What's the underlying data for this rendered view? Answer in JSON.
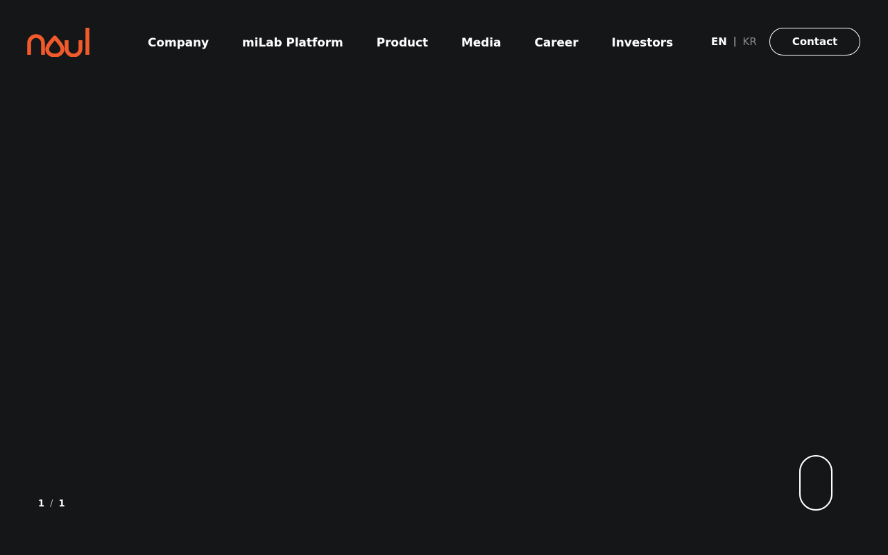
{
  "brand": {
    "logo_icon": "noul-logo",
    "accent_color": "#F15A2B"
  },
  "nav": {
    "items": [
      {
        "label": "Company"
      },
      {
        "label": "miLab Platform"
      },
      {
        "label": "Product"
      },
      {
        "label": "Media"
      },
      {
        "label": "Career"
      },
      {
        "label": "Investors"
      }
    ]
  },
  "language": {
    "active": "EN",
    "separator": "|",
    "other": "KR"
  },
  "header": {
    "contact_label": "Contact"
  },
  "pagination": {
    "current": "1",
    "separator": "/",
    "total": "1"
  },
  "scroll_indicator": {
    "icon": "mouse-scroll-icon"
  },
  "theme": {
    "background": "#151618",
    "text": "#FFFFFF",
    "muted": "#8A8B8E"
  }
}
